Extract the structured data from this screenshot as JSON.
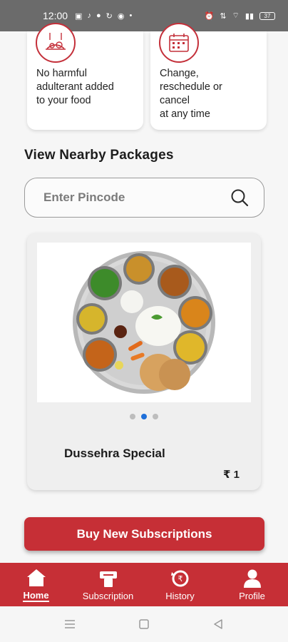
{
  "status_bar": {
    "time": "12:00",
    "battery": "37"
  },
  "features": [
    {
      "icon": "food-plate-icon",
      "text_lines": [
        "No harmful",
        "adulterant added",
        "to your food"
      ]
    },
    {
      "icon": "calendar-icon",
      "text_lines": [
        "Change,",
        "reschedule or",
        "cancel",
        "at any time"
      ]
    }
  ],
  "nearby": {
    "title": "View Nearby Packages",
    "search_placeholder": "Enter Pincode"
  },
  "package": {
    "name": "Dussehra Special",
    "price": "₹ 1",
    "carousel_dots": 3,
    "active_dot": 1,
    "image": "thali-plate"
  },
  "buy_button": "Buy New Subscriptions",
  "bottom_nav": [
    {
      "label": "Home",
      "icon": "home-icon",
      "active": true
    },
    {
      "label": "Subscription",
      "icon": "subscription-icon",
      "active": false
    },
    {
      "label": "History",
      "icon": "history-icon",
      "active": false
    },
    {
      "label": "Profile",
      "icon": "profile-icon",
      "active": false
    }
  ],
  "colors": {
    "brand_red": "#c62f36",
    "active_dot": "#1e6fd9"
  }
}
